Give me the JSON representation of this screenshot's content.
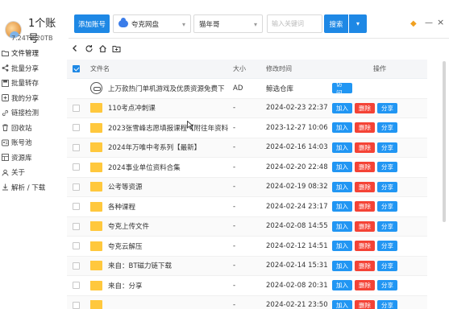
{
  "account": {
    "name": "1个账号",
    "storage": "7.24TB/20TB"
  },
  "sidebar": {
    "items": [
      {
        "label": "文件管理",
        "icon": "folder-icon"
      },
      {
        "label": "批量分享",
        "icon": "share-icon"
      },
      {
        "label": "批量转存",
        "icon": "save-icon"
      },
      {
        "label": "我的分享",
        "icon": "my-share-icon"
      },
      {
        "label": "链接检测",
        "icon": "link-check-icon"
      },
      {
        "label": "回收站",
        "icon": "trash-icon"
      },
      {
        "label": "账号池",
        "icon": "account-pool-icon"
      },
      {
        "label": "资源库",
        "icon": "library-icon"
      },
      {
        "label": "关于",
        "icon": "info-icon"
      },
      {
        "label": "解析 / 下载",
        "icon": "download-icon"
      }
    ]
  },
  "toolbar": {
    "add_account": "添加账号",
    "drive": "夸克网盘",
    "keyword_select": "猫年哥",
    "search_placeholder": "输入关键词",
    "search": "搜索"
  },
  "table": {
    "headers": {
      "name": "文件名",
      "size": "大小",
      "time": "修改时间",
      "actions": "操作"
    },
    "rows": [
      {
        "name": "上万款热门单机游戏及优质资源免费下",
        "size": "AD",
        "time": "鲸选仓库",
        "type": "ad",
        "visit": "访 问"
      },
      {
        "name": "110考点冲刺课",
        "size": "-",
        "time": "2024-02-23 22:37",
        "type": "folder"
      },
      {
        "name": "2023张雪峰志愿填报课程【附往年资料",
        "size": "-",
        "time": "2023-12-27 10:06",
        "type": "folder"
      },
      {
        "name": "2024年万唯中考系列【最新】",
        "size": "-",
        "time": "2024-02-16 14:03",
        "type": "folder"
      },
      {
        "name": "2024事业单位资料合集",
        "size": "-",
        "time": "2024-02-20 22:48",
        "type": "folder"
      },
      {
        "name": "公考等资源",
        "size": "-",
        "time": "2024-02-19 08:32",
        "type": "folder"
      },
      {
        "name": "各种课程",
        "size": "-",
        "time": "2024-02-24 23:17",
        "type": "folder"
      },
      {
        "name": "夸克上传文件",
        "size": "-",
        "time": "2024-02-08 14:55",
        "type": "folder"
      },
      {
        "name": "夸克云解压",
        "size": "-",
        "time": "2024-02-12 14:51",
        "type": "folder"
      },
      {
        "name": "来自：BT磁力链下载",
        "size": "-",
        "time": "2024-02-14 15:31",
        "type": "folder"
      },
      {
        "name": "来自：分享",
        "size": "-",
        "time": "2024-02-08 20:31",
        "type": "folder"
      },
      {
        "name": "",
        "size": "-",
        "time": "2024-02-21 23:50",
        "type": "folder"
      }
    ],
    "actions": {
      "add": "加入",
      "delete": "删除",
      "share": "分享"
    }
  },
  "colors": {
    "primary": "#1e88e5",
    "danger": "#f44336",
    "folder": "#ffc83d"
  }
}
